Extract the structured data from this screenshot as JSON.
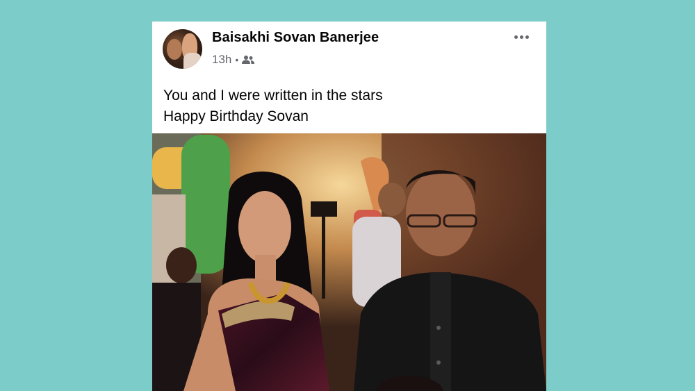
{
  "post": {
    "author": "Baisakhi Sovan Banerjee",
    "timestamp": "13h",
    "separator": "•",
    "audience_icon": "friends-icon",
    "more_icon": "more-options-icon",
    "text_lines": [
      "You and I were written in the stars",
      "Happy Birthday Sovan"
    ],
    "photo_icon": "post-photo"
  },
  "colors": {
    "background": "#7ccdc9",
    "card": "#ffffff",
    "author_text": "#050505",
    "meta_text": "#65676b"
  }
}
